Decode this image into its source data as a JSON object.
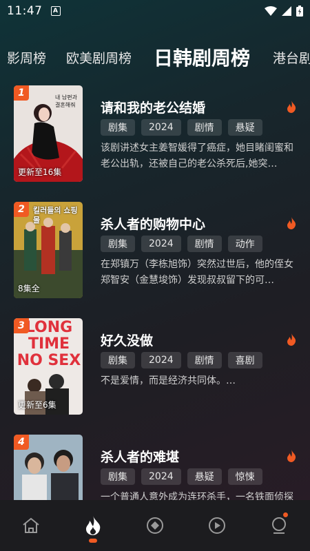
{
  "status_bar": {
    "time": "11:47",
    "notif": "A"
  },
  "tabs": [
    "影周榜",
    "欧美剧周榜",
    "日韩剧周榜",
    "港台剧"
  ],
  "active_tab": 2,
  "items": [
    {
      "rank": "1",
      "title": "请和我的老公结婚",
      "tags": [
        "剧集",
        "2024",
        "剧情",
        "悬疑"
      ],
      "desc": "该剧讲述女主姜智媛得了癌症，她目睹闺蜜和老公出轨，还被自己的老公杀死后,她突…",
      "poster_status": "更新至16集",
      "poster_text": "내 남편과 결혼해줘"
    },
    {
      "rank": "2",
      "title": "杀人者的购物中心",
      "tags": [
        "剧集",
        "2024",
        "剧情",
        "动作"
      ],
      "desc": "在郑镇万（李栋旭饰）突然过世后，他的侄女郑智安（金慧埈饰）发现叔叔留下的可…",
      "poster_status": "8集全",
      "poster_text": "킬러들의 쇼핑몰"
    },
    {
      "rank": "3",
      "title": "好久没做",
      "tags": [
        "剧集",
        "2024",
        "剧情",
        "喜剧"
      ],
      "desc": "不是爱情，而是经济共同体。…",
      "poster_status": "更新至6集",
      "poster_text": "LONG TIME NO SEX"
    },
    {
      "rank": "4",
      "title": "杀人者的难堪",
      "tags": [
        "剧集",
        "2024",
        "悬疑",
        "惊悚"
      ],
      "desc": "一个普通人意外成为连环杀手，一名铁面侦探紧追不舍…",
      "poster_status": "",
      "poster_text": ""
    }
  ],
  "icons": {
    "hot": "flame-icon",
    "nav": [
      "home-icon",
      "flame-icon",
      "compass-icon",
      "play-icon",
      "profile-icon"
    ]
  },
  "colors": {
    "accent": "#f05a23",
    "nav_bg": "#1c1c1f"
  }
}
